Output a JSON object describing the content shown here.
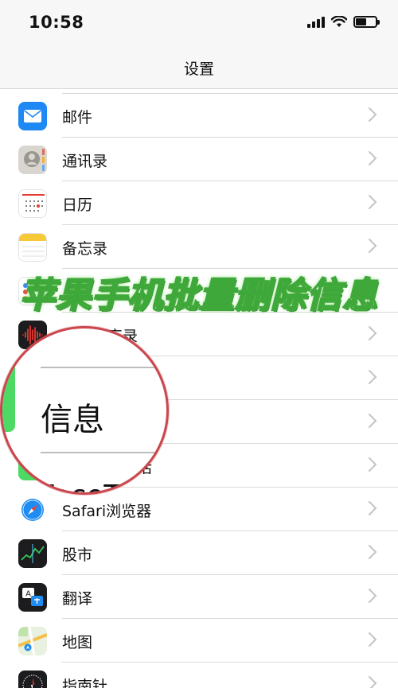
{
  "status": {
    "time": "10:58"
  },
  "nav": {
    "title": "设置"
  },
  "rows": [
    {
      "label": "邮件",
      "icon": "mail-icon"
    },
    {
      "label": "通讯录",
      "icon": "contacts-icon"
    },
    {
      "label": "日历",
      "icon": "calendar-icon"
    },
    {
      "label": "备忘录",
      "icon": "notes-icon"
    },
    {
      "label": "",
      "icon": "reminders-icon"
    },
    {
      "label": "语音备忘录",
      "icon": "voice-memos-icon"
    },
    {
      "label": "",
      "icon": "phone-icon"
    },
    {
      "label": "",
      "icon": "messages-icon"
    },
    {
      "label": "话",
      "icon": "facetime-icon"
    },
    {
      "label": "Safari浏览器",
      "icon": "safari-icon"
    },
    {
      "label": "股市",
      "icon": "stocks-icon"
    },
    {
      "label": "翻译",
      "icon": "translate-icon"
    },
    {
      "label": "地图",
      "icon": "maps-icon"
    },
    {
      "label": "指南针",
      "icon": "compass-icon"
    }
  ],
  "overlay": {
    "banner": "苹果手机批量删除信息",
    "magnified_label": "信息",
    "magnified_next": "FaceTi"
  },
  "colors": {
    "banner_stroke": "#3fa83a",
    "magnifier_ring": "#c9474d",
    "chevron": "#c4c4c6"
  }
}
